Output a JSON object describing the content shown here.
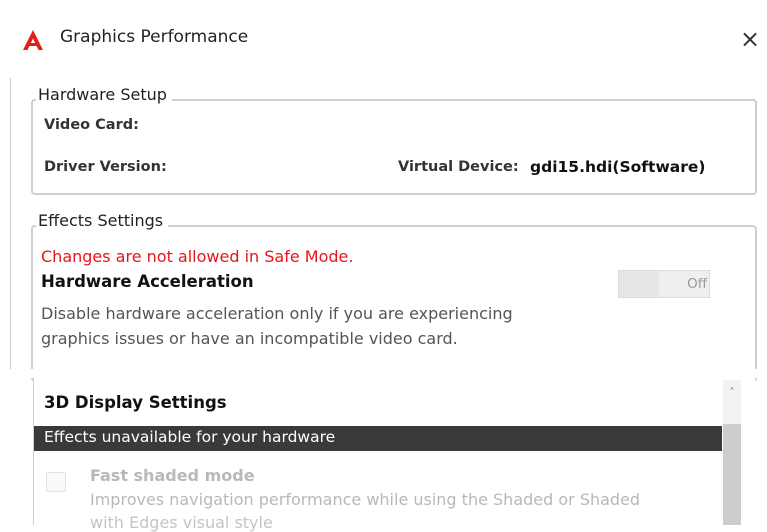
{
  "window": {
    "title": "Graphics Performance",
    "close_symbol": "×",
    "logo_icon": "autocad-a-logo",
    "logo_color": "#e0201b"
  },
  "hardware_setup": {
    "legend": "Hardware Setup",
    "video_card_label": "Video Card:",
    "driver_version_label": "Driver Version:",
    "virtual_device_label": "Virtual Device:",
    "virtual_device_value": "gdi15.hdi(Software)"
  },
  "effects_settings": {
    "legend": "Effects Settings",
    "safe_mode_message": "Changes are not allowed in Safe Mode.",
    "safe_mode_color": "#e8141c",
    "hardware_acceleration_title": "Hardware Acceleration",
    "hardware_acceleration_desc_line1": "Disable hardware acceleration only if you are experiencing",
    "hardware_acceleration_desc_line2": "graphics issues or have an incompatible video card.",
    "toggle_state": "Off"
  },
  "display_3d": {
    "title": "3D Display Settings",
    "unavailable_banner": "Effects unavailable for your hardware",
    "fast_shaded_label": "Fast shaded mode",
    "fast_shaded_desc": "Improves navigation performance while using the Shaded or Shaded",
    "fast_shaded_desc_cont": "with Edges visual style"
  }
}
